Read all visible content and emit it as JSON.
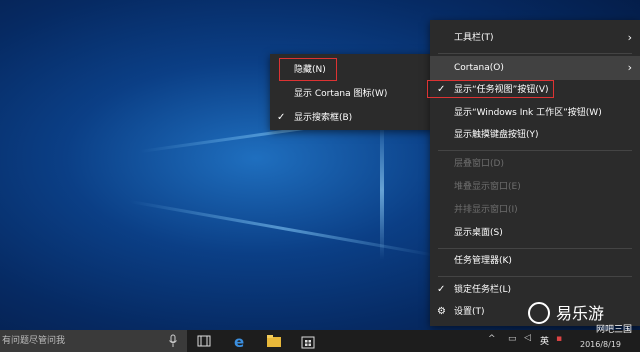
{
  "left_menu": {
    "items": [
      {
        "label": "隐藏(N)",
        "checked": false,
        "highlight": true
      },
      {
        "label": "显示 Cortana 图标(W)",
        "checked": false
      },
      {
        "label": "显示搜索框(B)",
        "checked": true
      }
    ]
  },
  "right_menu": {
    "toolbar_label": "工具栏(T)",
    "cortana_label": "Cortana(O)",
    "task_view_label": "显示“任务视图”按钮(V)",
    "ink_label": "显示“Windows Ink 工作区”按钮(W)",
    "touch_kb_label": "显示触摸键盘按钮(Y)",
    "cascade_label": "层叠窗口(D)",
    "stack_label": "堆叠显示窗口(E)",
    "side_label": "并排显示窗口(I)",
    "desktop_label": "显示桌面(S)",
    "task_manager_label": "任务管理器(K)",
    "lock_label": "锁定任务栏(L)",
    "settings_label": "设置(T)"
  },
  "taskbar": {
    "search_placeholder": "有问题尽管问我",
    "ime_label": "英",
    "date": "2016/8/19"
  },
  "watermark": {
    "brand": "易乐游",
    "site": "网吧三国"
  },
  "colors": {
    "menu_bg": "#2b2b2b",
    "highlight_border": "#dd3333",
    "disabled": "#6e6e6e"
  }
}
